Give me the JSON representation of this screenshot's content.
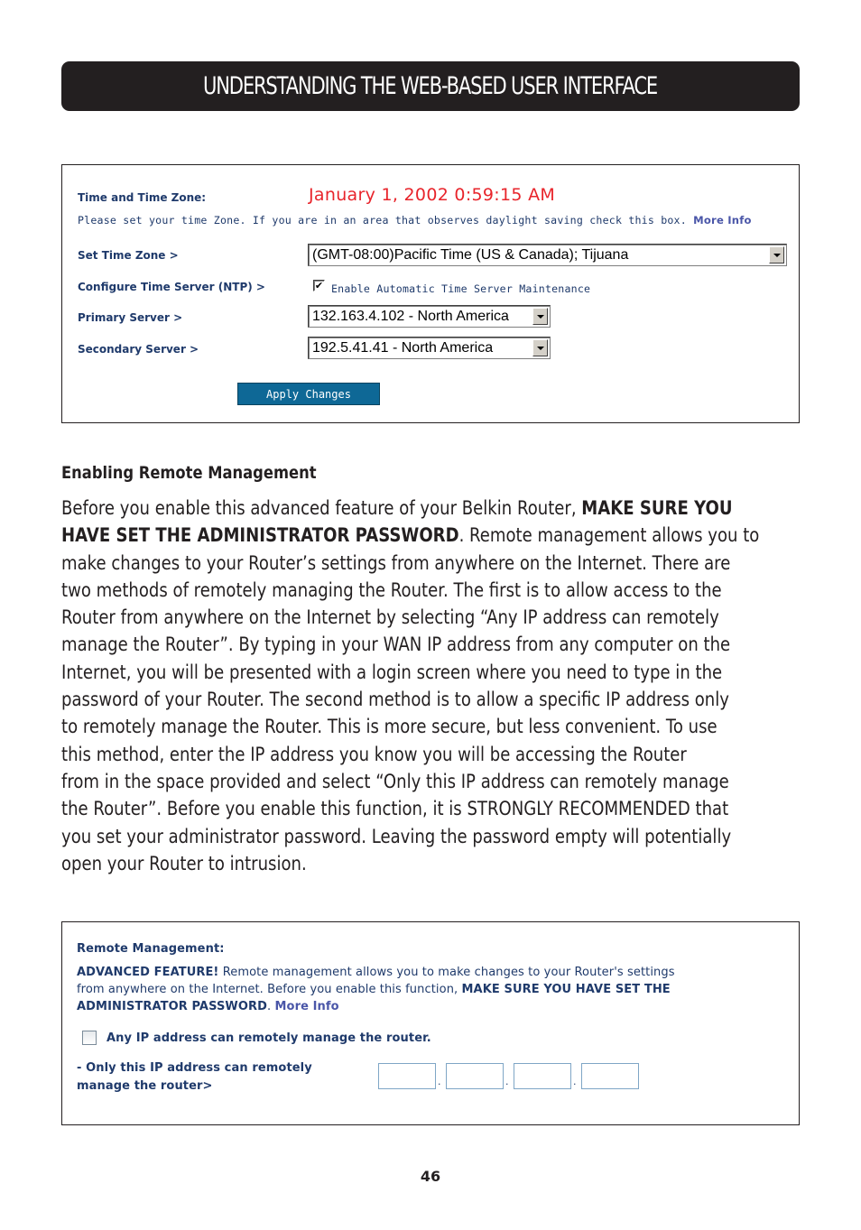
{
  "page": {
    "title": "UNDERSTANDING THE WEB-BASED USER INTERFACE",
    "page_number": "46"
  },
  "time_panel": {
    "heading": "Time and Time Zone:",
    "current_datetime": "January 1, 2002 0:59:15 AM",
    "instruction": "Please set your time Zone. If you are in an area that observes daylight saving check this box.",
    "more_info": "More Info",
    "set_time_zone_label": "Set Time Zone >",
    "time_zone_value": "(GMT-08:00)Pacific Time (US & Canada); Tijuana",
    "ntp_label": "Configure Time Server (NTP) >",
    "ntp_checkbox_checked": true,
    "ntp_checkbox_label": "Enable Automatic Time Server Maintenance",
    "primary_server_label": "Primary Server >",
    "primary_server_value": "132.163.4.102 - North America",
    "secondary_server_label": "Secondary Server >",
    "secondary_server_value": "192.5.41.41 - North America",
    "apply_button": "Apply Changes",
    "check_mark": "✔"
  },
  "body": {
    "heading": "Enabling Remote Management",
    "lines": [
      {
        "pre": "Before you enable this advanced feature of your Belkin Router, ",
        "bold": "MAKE SURE YOU",
        "post": ""
      },
      {
        "pre": "",
        "bold": "HAVE SET THE ADMINISTRATOR PASSWORD",
        "post": ". Remote management allows you to"
      },
      {
        "pre": "make changes to your Router’s settings from anywhere on the Internet. There are",
        "bold": "",
        "post": ""
      },
      {
        "pre": "two methods of remotely managing the Router. The first is to allow access to the",
        "bold": "",
        "post": ""
      },
      {
        "pre": "Router from anywhere on the Internet by selecting “Any IP address can remotely",
        "bold": "",
        "post": ""
      },
      {
        "pre": "manage the Router”. By typing in your WAN IP address from any computer on the",
        "bold": "",
        "post": ""
      },
      {
        "pre": "Internet, you will be presented with a login screen where you need to type in the",
        "bold": "",
        "post": ""
      },
      {
        "pre": "password of your Router. The second method is to allow a specific IP address only",
        "bold": "",
        "post": ""
      },
      {
        "pre": "to remotely manage the Router. This is more secure, but less convenient. To use",
        "bold": "",
        "post": ""
      },
      {
        "pre": "this method, enter the IP address you know you will be accessing the Router",
        "bold": "",
        "post": ""
      },
      {
        "pre": "from in the space provided and select “Only this IP address can remotely manage",
        "bold": "",
        "post": ""
      },
      {
        "pre": "the Router”. Before you enable this function, it is STRONGLY RECOMMENDED that",
        "bold": "",
        "post": ""
      },
      {
        "pre": "you set your administrator password. Leaving the password empty will potentially",
        "bold": "",
        "post": ""
      },
      {
        "pre": "open your Router to intrusion.",
        "bold": "",
        "post": ""
      }
    ]
  },
  "remote_panel": {
    "heading": "Remote Management:",
    "line1_bold": "ADVANCED FEATURE!",
    "line1_rest": " Remote management allows you to make changes to your Router's settings",
    "line2_rest": "from anywhere on the Internet. Before you enable this function, ",
    "line2_bold": "MAKE SURE YOU HAVE SET THE",
    "line3_bold": "ADMINISTRATOR PASSWORD",
    "line3_rest": ". ",
    "more_info": "More Info",
    "any_ip_checked": false,
    "any_ip_label": "Any IP address can remotely manage the router.",
    "only_ip_label_line1": "- Only this IP address can remotely",
    "only_ip_label_line2": "manage the router>",
    "ip_octets": [
      "",
      "",
      "",
      ""
    ],
    "ip_separator": "."
  }
}
